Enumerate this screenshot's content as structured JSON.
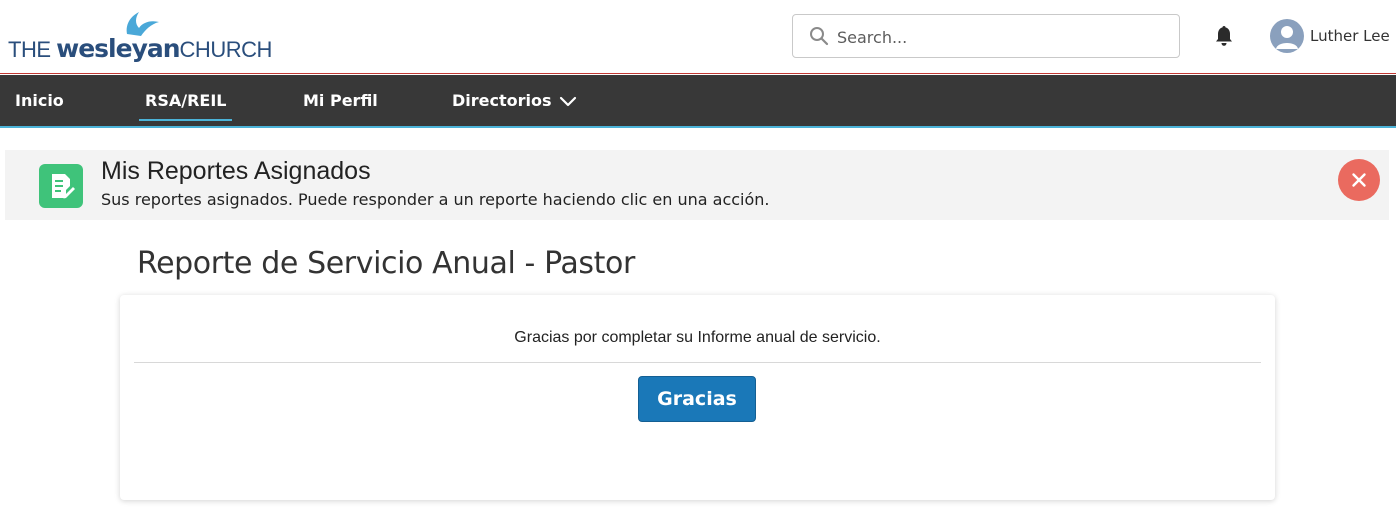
{
  "header": {
    "logo": {
      "the": "THE ",
      "wesleyan": "wesleyan",
      "church": "CHURCH"
    },
    "search": {
      "placeholder": "Search...",
      "value": ""
    },
    "user": {
      "name": "Luther Lee"
    }
  },
  "nav": {
    "items": [
      {
        "label": "Inicio"
      },
      {
        "label": "RSA/REIL"
      },
      {
        "label": "Mi Perfil"
      },
      {
        "label": "Directorios"
      }
    ],
    "active_index": 1
  },
  "banner": {
    "title": "Mis Reportes Asignados",
    "subtitle": "Sus reportes asignados. Puede responder a un reporte haciendo clic en una acción."
  },
  "page": {
    "title": "Reporte de Servicio Anual - Pastor"
  },
  "card": {
    "message": "Gracias por completar su Informe anual de servicio.",
    "button_label": "Gracias"
  },
  "colors": {
    "nav_bg": "#383838",
    "accent_blue": "#4bb3d8",
    "banner_icon_green": "#3fc37a",
    "close_red": "#ea6a5f",
    "button_blue": "#1a78b8",
    "brand_navy": "#2a4e7c"
  },
  "icons": {
    "search": "search-icon",
    "bell": "bell-icon",
    "avatar": "user-avatar-icon",
    "chevron": "chevron-down-icon",
    "banner": "report-icon",
    "close": "close-icon",
    "logo_mark": "flame-logo-icon"
  }
}
